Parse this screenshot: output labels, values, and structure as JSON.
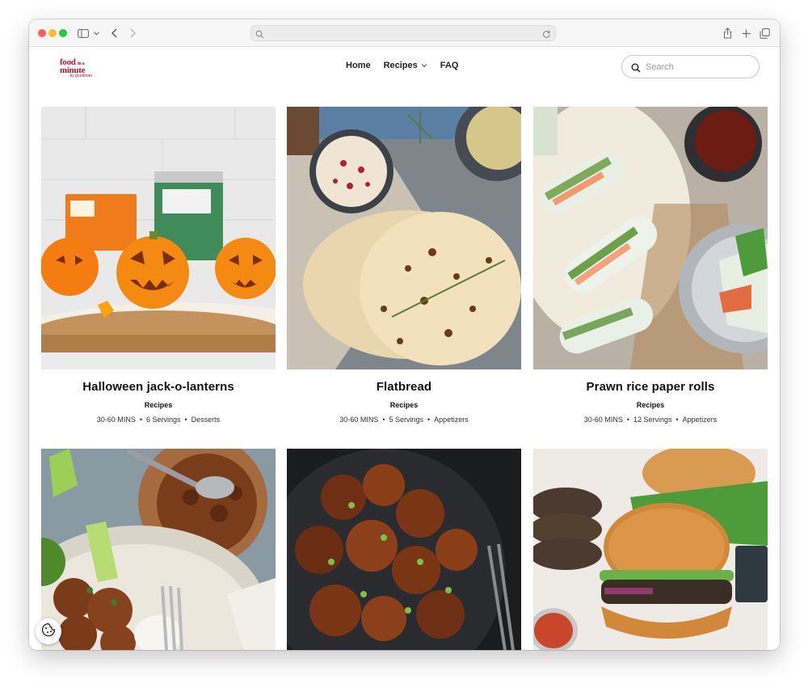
{
  "browser": {
    "url": "",
    "icons": [
      "sidebar-icon",
      "chevron-down-icon",
      "back-icon",
      "forward-icon",
      "search-icon",
      "reload-icon",
      "share-icon",
      "new-tab-icon",
      "tabs-overview-icon"
    ]
  },
  "site": {
    "logo": {
      "line1": "food",
      "line1_small": "in a",
      "line2": "minute",
      "line3": "by goodman"
    },
    "nav": [
      {
        "label": "Home"
      },
      {
        "label": "Recipes"
      },
      {
        "label": "FAQ"
      }
    ],
    "search": {
      "placeholder": "Search"
    },
    "colors": {
      "brand": "#c8102e",
      "text": "#111111"
    }
  },
  "recipes": [
    {
      "title": "Halloween jack-o-lanterns",
      "category": "Recipes",
      "time": "30-60 MINS",
      "servings": "6 Servings",
      "course": "Desserts"
    },
    {
      "title": "Flatbread",
      "category": "Recipes",
      "time": "30-60 MINS",
      "servings": "5 Servings",
      "course": "Appetizers"
    },
    {
      "title": "Prawn rice paper rolls",
      "category": "Recipes",
      "time": "30-60 MINS",
      "servings": "12 Servings",
      "course": "Appetizers"
    },
    {
      "title": "",
      "category": "",
      "time": "",
      "servings": "",
      "course": ""
    },
    {
      "title": "",
      "category": "",
      "time": "",
      "servings": "",
      "course": ""
    },
    {
      "title": "",
      "category": "",
      "time": "",
      "servings": "",
      "course": ""
    }
  ],
  "meta_separator": "•",
  "cookie_button": {
    "icon": "cookie-icon"
  }
}
